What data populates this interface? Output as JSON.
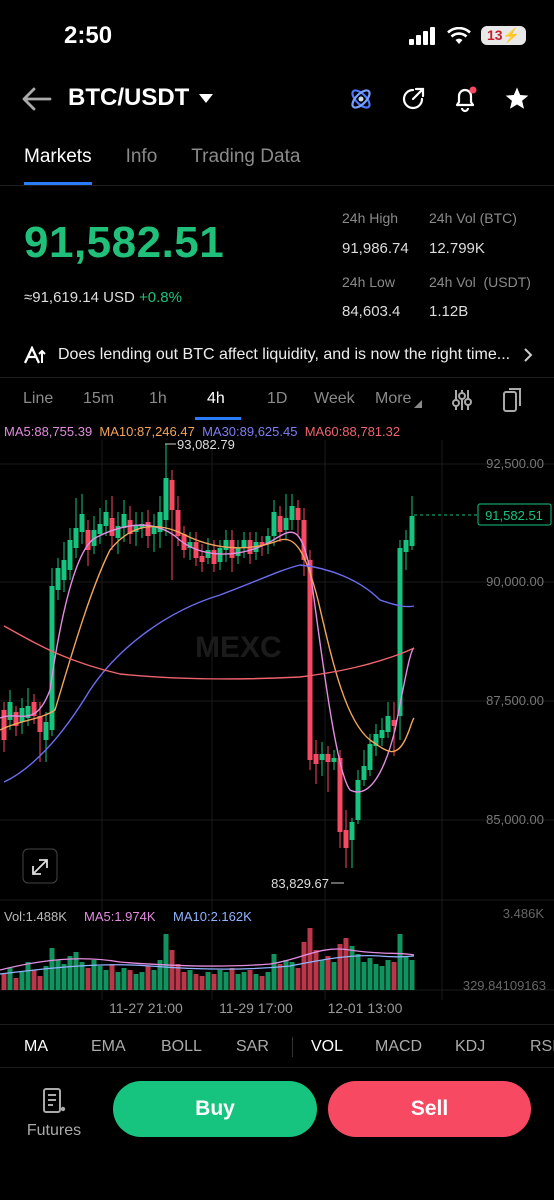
{
  "status": {
    "time": "2:50",
    "battery": "13"
  },
  "header": {
    "pair": "BTC/USDT"
  },
  "tabs": [
    {
      "label": "Markets"
    },
    {
      "label": "Info"
    },
    {
      "label": "Trading Data"
    }
  ],
  "ticker": {
    "price": "91,582.51",
    "approx": "≈91,619.14",
    "currency": "USD",
    "change": "+0.8%",
    "high_label": "24h High",
    "high": "91,986.74",
    "vol_btc_label": "24h Vol (BTC)",
    "vol_btc": "12.799K",
    "low_label": "24h Low",
    "low": "84,603.4",
    "vol_usdt_label": "24h Vol  (USDT)",
    "vol_usdt": "1.12B"
  },
  "news": {
    "text": "Does lending out BTC affect liquidity, and is now the right time..."
  },
  "intervals": [
    {
      "label": "Line"
    },
    {
      "label": "15m"
    },
    {
      "label": "1h"
    },
    {
      "label": "4h"
    },
    {
      "label": "1D"
    },
    {
      "label": "Week"
    },
    {
      "label": "More"
    }
  ],
  "ma_legend": {
    "ma5": "MA5:88,755.39",
    "ma10": "MA10:87,246.47",
    "ma30": "MA30:89,625.45",
    "ma60": "MA60:88,781.32"
  },
  "colors": {
    "up": "#16c47f",
    "down": "#f84963",
    "ma5": "#e28de0",
    "ma10": "#f3a55a",
    "ma30": "#6b6cf0",
    "ma60": "#f0636d"
  },
  "chart": {
    "y_labels": [
      "92,500.00",
      "90,000.00",
      "87,500.00",
      "85,000.00"
    ],
    "high_marker": "93,082.79",
    "low_marker": "83,829.67",
    "last_price_tag": "91,582.51",
    "x_labels": [
      "11-27 21:00",
      "11-29 17:00",
      "12-01 13:00"
    ],
    "watermark": "MEXC",
    "volume": {
      "vol": "Vol:1.488K",
      "ma5": "MA5:1.974K",
      "ma10": "MA10:2.162K",
      "max": "3.486K",
      "min": "329.84109163"
    }
  },
  "chart_data": {
    "type": "candlestick",
    "y_axis_ticks": [
      92500,
      90000,
      87500,
      85000
    ],
    "ylim": [
      84000,
      93200
    ],
    "x_tick_labels": [
      "11-27 21:00",
      "11-29 17:00",
      "12-01 13:00"
    ],
    "high": 93082.79,
    "low": 83829.67,
    "last_price": 91582.51,
    "series": [
      {
        "name": "MA5",
        "last": 88755.39
      },
      {
        "name": "MA10",
        "last": 87246.47
      },
      {
        "name": "MA30",
        "last": 89625.45
      },
      {
        "name": "MA60",
        "last": 88781.32
      }
    ],
    "volume_range": [
      329.84109163,
      3486
    ]
  },
  "indicators": [
    {
      "label": "MA"
    },
    {
      "label": "EMA"
    },
    {
      "label": "BOLL"
    },
    {
      "label": "SAR"
    },
    {
      "label": "VOL"
    },
    {
      "label": "MACD"
    },
    {
      "label": "KDJ"
    },
    {
      "label": "RSI"
    }
  ],
  "actions": {
    "futures": "Futures",
    "buy": "Buy",
    "sell": "Sell"
  }
}
